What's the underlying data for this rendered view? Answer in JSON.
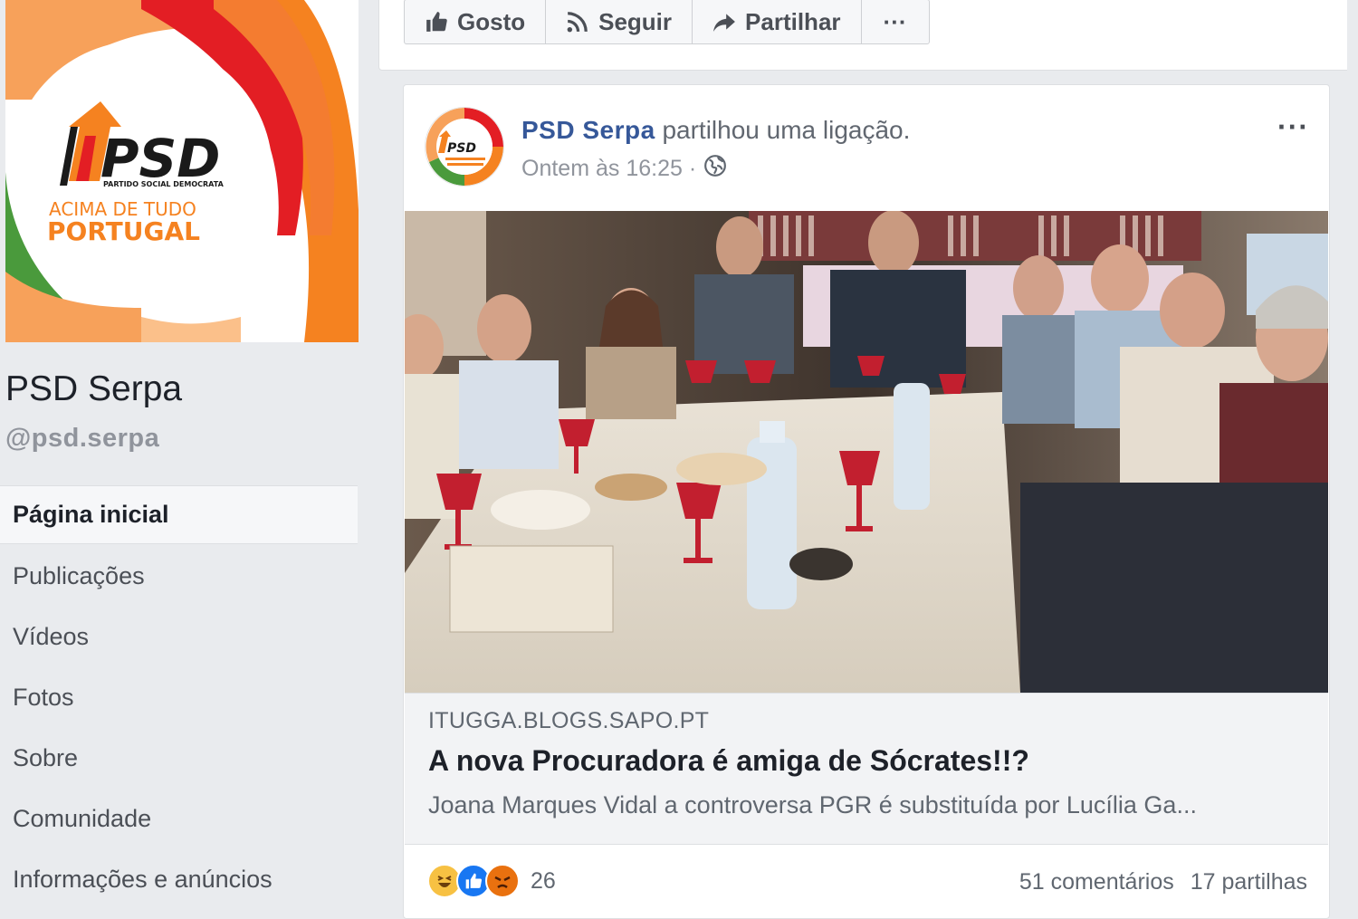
{
  "page": {
    "name": "PSD Serpa",
    "handle": "@psd.serpa"
  },
  "logo": {
    "wordmark": "PSD",
    "party_full": "PARTIDO SOCIAL DEMOCRATA",
    "slogan_line1": "ACIMA DE TUDO",
    "slogan_line2": "PORTUGAL",
    "colors": {
      "orange": "#f58220",
      "red": "#e31e24",
      "green": "#4a9a3c",
      "dark": "#1a1a1a"
    }
  },
  "nav": [
    {
      "label": "Página inicial",
      "active": true
    },
    {
      "label": "Publicações"
    },
    {
      "label": "Vídeos"
    },
    {
      "label": "Fotos"
    },
    {
      "label": "Sobre"
    },
    {
      "label": "Comunidade"
    },
    {
      "label": "Informações e anúncios"
    }
  ],
  "actions": {
    "like": "Gosto",
    "follow": "Seguir",
    "share": "Partilhar",
    "more": "···"
  },
  "post": {
    "author": "PSD Serpa",
    "action_text": "partilhou uma ligação.",
    "timestamp": "Ontem às 16:25 ·",
    "privacy_icon": "globe-icon",
    "menu": "···",
    "link": {
      "domain": "ITUGGA.BLOGS.SAPO.PT",
      "title": "A nova Procuradora é amiga de Sócrates!!?",
      "description": "Joana Marques Vidal a controversa PGR é substituída por Lucília Ga..."
    },
    "reactions": {
      "types": [
        "haha",
        "like",
        "angry"
      ],
      "count": "26"
    },
    "comments": "51 comentários",
    "shares": "17 partilhas"
  },
  "colors": {
    "link_blue": "#365899",
    "like_blue": "#1877f2",
    "background": "#e9ebee"
  }
}
